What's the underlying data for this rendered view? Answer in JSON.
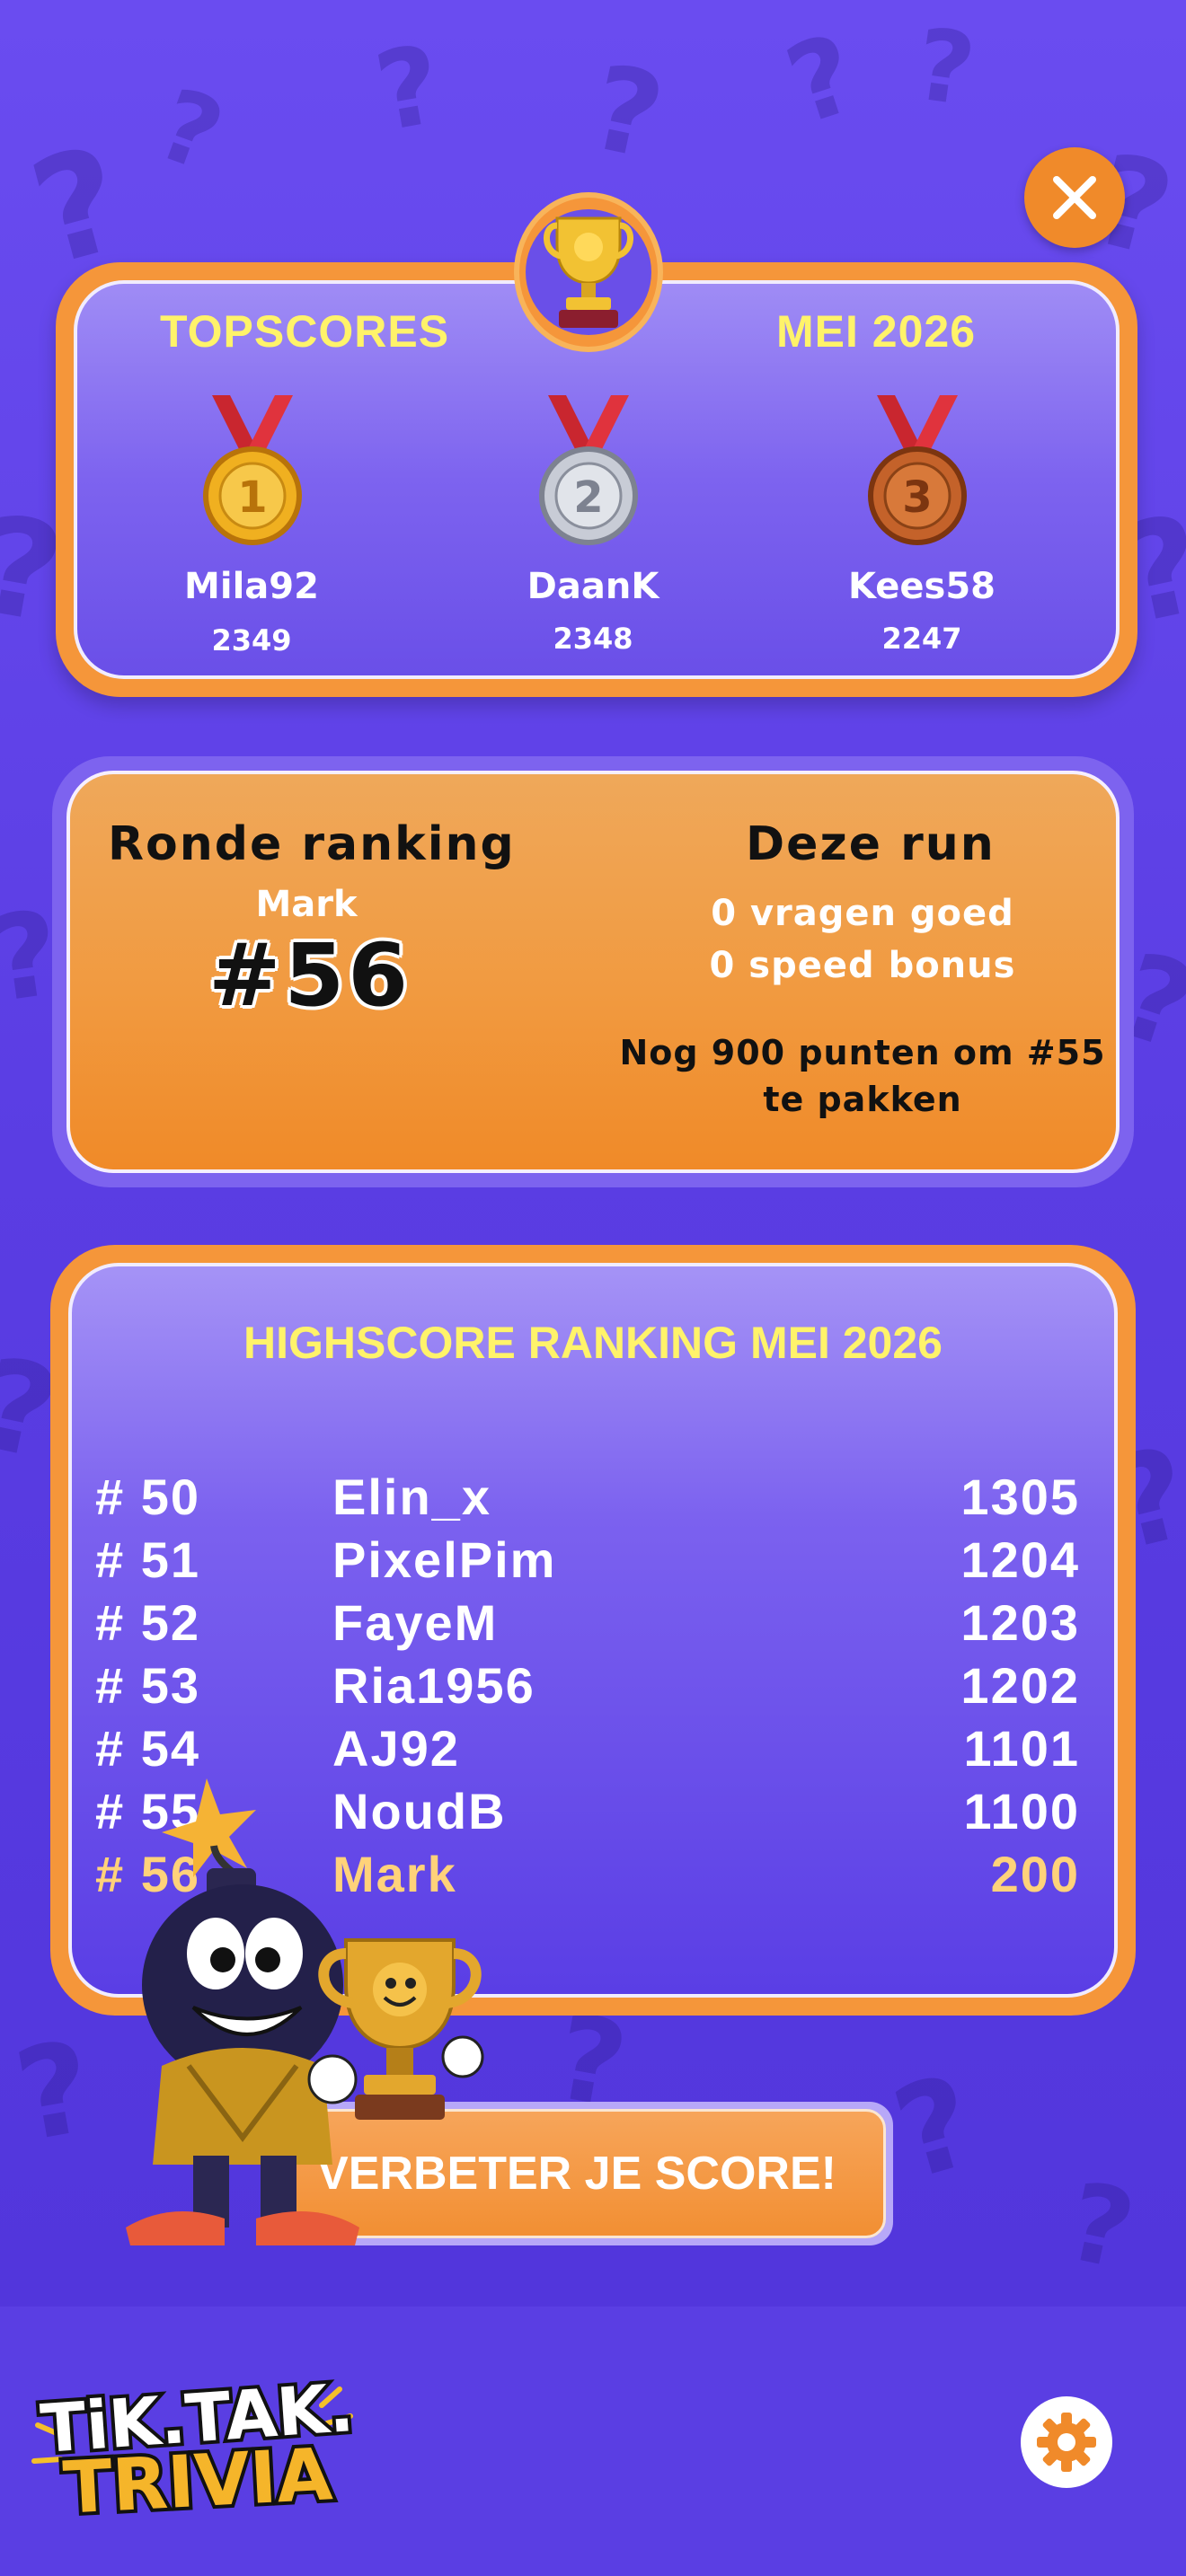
{
  "topscores": {
    "title": "TOPSCORES",
    "period": "MEI 2026",
    "podium": [
      {
        "place": "1",
        "name": "Mila92",
        "score": "2349"
      },
      {
        "place": "2",
        "name": "DaanK",
        "score": "2348"
      },
      {
        "place": "3",
        "name": "Kees58",
        "score": "2247"
      }
    ]
  },
  "round": {
    "title": "Ronde ranking",
    "player": "Mark",
    "rank": "#56",
    "run_title": "Deze run",
    "correct": "0 vragen goed",
    "speed": "0 speed bonus",
    "next_goal": "Nog 900 punten om #55 te pakken"
  },
  "highscore": {
    "title": "HIGHSCORE RANKING MEI 2026",
    "rows": [
      {
        "rank": "# 50",
        "name": "Elin_x",
        "score": "1305"
      },
      {
        "rank": "# 51",
        "name": "PixelPim",
        "score": "1204"
      },
      {
        "rank": "# 52",
        "name": "FayeM",
        "score": "1203"
      },
      {
        "rank": "# 53",
        "name": "Ria1956",
        "score": "1202"
      },
      {
        "rank": "# 54",
        "name": "AJ92",
        "score": "1101"
      },
      {
        "rank": "# 55",
        "name": "NoudB",
        "score": "1100"
      },
      {
        "rank": "# 56",
        "name": "Mark",
        "score": "200"
      }
    ]
  },
  "cta_label": "VERBETER JE SCORE!",
  "logo": {
    "line1": "TiK.TAK.",
    "line2": "TRIVIA"
  },
  "icons": {
    "close": "close-icon",
    "settings": "gear-icon",
    "trophy": "trophy-icon"
  },
  "colors": {
    "accent": "#f5963a",
    "highlight": "#fff36a",
    "background": "#5b3fe0",
    "me": "#ffd27a"
  }
}
